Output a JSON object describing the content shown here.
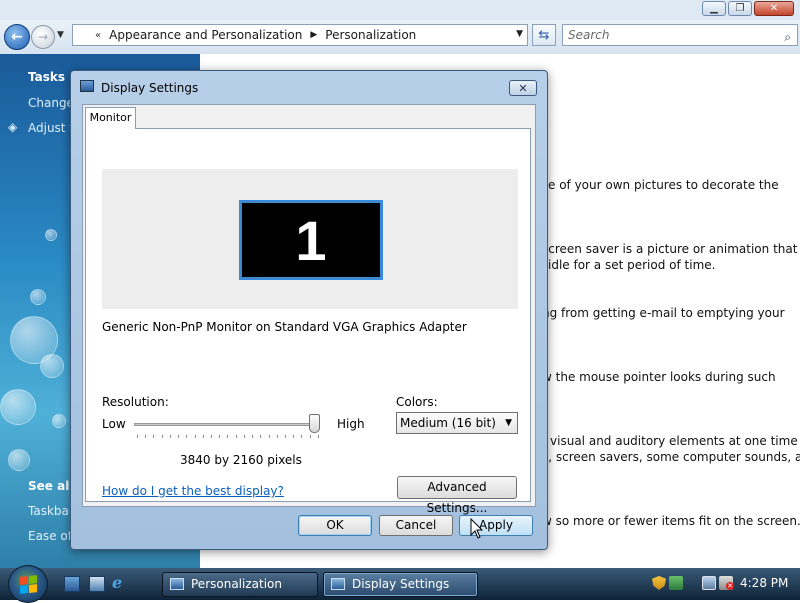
{
  "explorer": {
    "breadcrumb": [
      "Appearance and Personalization",
      "Personalization"
    ],
    "search_placeholder": "Search",
    "sidebar": {
      "tasks_heading": "Tasks",
      "tasks": [
        "Change",
        "Adjust f"
      ],
      "see_also_heading": "See also",
      "see_also": [
        "Taskbar",
        "Ease of"
      ]
    },
    "content_lines": [
      "e of your own pictures to decorate the",
      "screen saver is a picture or animation that",
      "idle for a set period of time.",
      "ng from getting e-mail to emptying your",
      "w the mouse pointer looks during such",
      "f visual and auditory elements at one time",
      "s, screen savers, some computer sounds, and",
      "w so more or fewer items fit on the screen."
    ]
  },
  "dialog": {
    "title": "Display Settings",
    "close_glyph": "✕",
    "tab": "Monitor",
    "monitor_number": "1",
    "monitor_name": "Generic Non-PnP Monitor on Standard VGA Graphics Adapter",
    "resolution_label": "Resolution:",
    "low_label": "Low",
    "high_label": "High",
    "resolution_value": "3840 by 2160 pixels",
    "resolution_slider_position": 1.0,
    "colors_label": "Colors:",
    "colors_value": "Medium (16 bit)",
    "help_link": "How do I get the best display?",
    "advanced_button": "Advanced Settings...",
    "ok_button": "OK",
    "cancel_button": "Cancel",
    "apply_button": "Apply"
  },
  "taskbar": {
    "buttons": [
      "Personalization",
      "Display Settings"
    ],
    "active_button": "Display Settings",
    "clock": "4:28 PM"
  },
  "colors": {
    "accent": "#3a8ad8",
    "link": "#0b5fbf",
    "sidebar": "#2a8ac4",
    "taskbar": "#1a3048"
  },
  "icons": [
    "back-arrow-icon",
    "forward-arrow-icon",
    "refresh-icon",
    "search-icon",
    "shield-icon",
    "windows-logo-icon",
    "show-desktop-icon",
    "switch-windows-icon",
    "internet-explorer-icon",
    "network-icon",
    "volume-muted-icon"
  ]
}
